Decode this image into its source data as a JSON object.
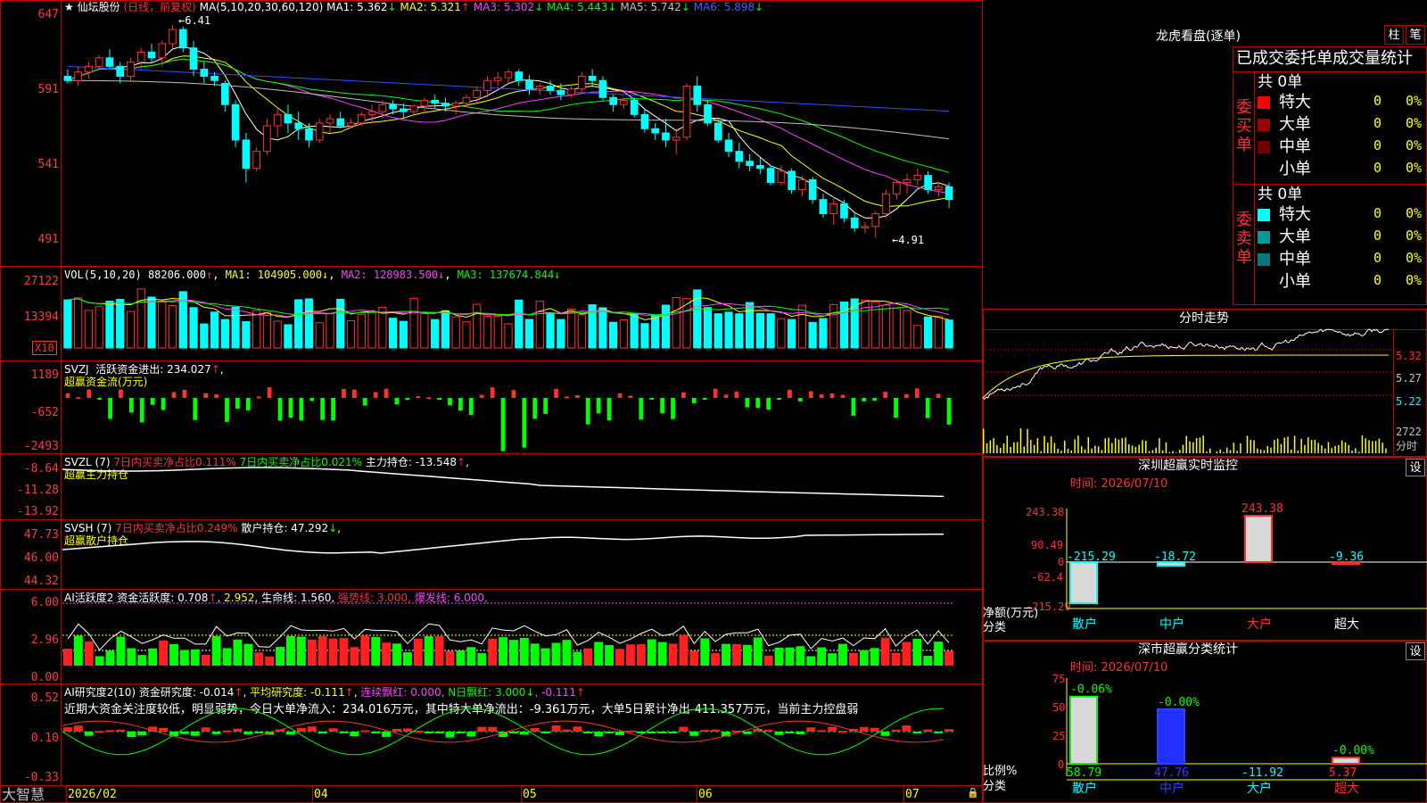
{
  "header": {
    "stock": "仙坛股份",
    "period": "(日线，前复权)",
    "ma_label": "MA(5,10,20,30,60,120)",
    "ma": [
      {
        "label": "MA1:",
        "value": "5.362",
        "arrow": "↓",
        "color": "#ffffff"
      },
      {
        "label": "MA2:",
        "value": "5.321",
        "arrow": "↑",
        "color": "#ffff00"
      },
      {
        "label": "MA3:",
        "value": "5.302",
        "arrow": "↓",
        "color": "#ff40ff"
      },
      {
        "label": "MA4:",
        "value": "5.443",
        "arrow": "↓",
        "color": "#00ff00"
      },
      {
        "label": "MA5:",
        "value": "5.742",
        "arrow": "↓",
        "color": "#c0c0c0"
      },
      {
        "label": "MA6:",
        "value": "5.898",
        "arrow": "↓",
        "color": "#3050ff"
      }
    ],
    "high_label": "6.41",
    "low_label": "4.91"
  },
  "axes": {
    "price": [
      "647",
      "591",
      "541",
      "491"
    ],
    "vol": [
      "27122",
      "13394"
    ],
    "vol_unit": "X10",
    "svzj": [
      "1189",
      "-652",
      "-2493"
    ],
    "svzl": [
      "-8.64",
      "-11.28",
      "-13.92"
    ],
    "svsh": [
      "47.73",
      "46.00",
      "44.32"
    ],
    "ai1": [
      "6.00",
      "2.96",
      "0.00"
    ],
    "ai2": [
      "0.52",
      "0.10",
      "-0.33"
    ]
  },
  "panels": {
    "vol": {
      "label": "VOL(5,10,20)",
      "value": "88206.000",
      "v_arrow": "↑",
      "ma1": "MA1: 104905.000↓",
      "ma2": "MA2: 128983.500↓",
      "ma3": "MA3: 137674.844↓"
    },
    "svzj": {
      "label": "SVZJ",
      "text": "活跃资金进出: 234.027",
      "arrow": "↑",
      "comma": ",",
      "sub": "超赢资金流(万元)"
    },
    "svzl": {
      "label": "SVZL (7)",
      "t1": "7日内买卖净占比0.111%",
      "t2": "7日内买卖净占比0.021%",
      "t3": "主力持仓: -13.548",
      "arrow": "↑",
      "comma": ",",
      "sub": "超赢主力持仓"
    },
    "svsh": {
      "label": "SVSH (7)",
      "t1": "7日内买卖净占比0.249%",
      "t2": "散户持仓: 47.292",
      "arrow": "↓",
      "comma": ",",
      "sub": "超赢散户持仓"
    },
    "ai1": {
      "label": "AI活跃度2",
      "t1": "资金活跃度: 0.708",
      "a1": "↑",
      "t2": ", 2.952,",
      "t3": "生命线: 1.560,",
      "t4": "强势线: 3.000,",
      "t5": "爆发线: 6.000,"
    },
    "ai2": {
      "label": "AI研究度2(10)",
      "t1": "资金研究度: -0.014",
      "a1": "↑",
      "t2": "平均研究度: -0.111",
      "a2": "↑",
      "t3": "连续飘红: 0.000,",
      "t4": "N日飘红: 3.000",
      "a4": "↓",
      "t5": ", -0.111",
      "a5": "↑",
      "desc": "近期大资金关注度较低，明显弱势，今日大单净流入：234.016万元，其中特大单净流出：-9.361万元，大单5日累计净出-411.357万元，当前主力控盘弱"
    }
  },
  "footer": {
    "brand": "大智慧",
    "dates": [
      "2026/02",
      "04",
      "05",
      "06",
      "07"
    ]
  },
  "right": {
    "title": "龙虎看盘(逐单)",
    "tabs": [
      "柱",
      "笔"
    ],
    "subtitle": "已成交委托单成交量统计",
    "buy_group": "委买单",
    "sell_group": "委卖单",
    "buy_total": "共 0单",
    "sell_total": "共 0单",
    "buy_rows": [
      {
        "name": "特大",
        "vol": "0",
        "pct": "0%",
        "color": "#ff0000"
      },
      {
        "name": "大单",
        "vol": "0",
        "pct": "0%",
        "color": "#9a0000"
      },
      {
        "name": "中单",
        "vol": "0",
        "pct": "0%",
        "color": "#700000"
      },
      {
        "name": "小单",
        "vol": "0",
        "pct": "0%",
        "color": ""
      }
    ],
    "sell_rows": [
      {
        "name": "特大",
        "vol": "0",
        "pct": "0%",
        "color": "#00ffff"
      },
      {
        "name": "大单",
        "vol": "0",
        "pct": "0%",
        "color": "#009a9a"
      },
      {
        "name": "中单",
        "vol": "0",
        "pct": "0%",
        "color": "#007a7a"
      },
      {
        "name": "小单",
        "vol": "0",
        "pct": "0%",
        "color": ""
      }
    ],
    "intraday": {
      "title": "分时走势",
      "prices": [
        "5.32",
        "5.27",
        "5.22"
      ],
      "vol": "2722",
      "vol_unit": "分时"
    },
    "monitor": {
      "title": "深圳超赢实时监控",
      "set": "设",
      "time": "时间: 2026/07/10",
      "y": [
        "243.38",
        "90.49",
        "0",
        "-62.4",
        "-215.29"
      ],
      "ylabel": "净额(万元)",
      "xlabel": "分类",
      "cats": [
        "散户",
        "中户",
        "大户",
        "超大"
      ],
      "values": [
        -215.29,
        -18.72,
        243.38,
        -9.36
      ],
      "value_labels": [
        "-215.29",
        "-18.72",
        "243.38",
        "-9.36"
      ]
    },
    "stats": {
      "title": "深市超赢分类统计",
      "set": "设",
      "time": "时间: 2026/07/10",
      "y": [
        "75",
        "50",
        "25",
        "0"
      ],
      "ylabel": "比例%",
      "xlabel": "分类",
      "cats": [
        "散户",
        "中户",
        "大户",
        "超大"
      ],
      "values": [
        58.79,
        47.76,
        -11.92,
        5.37
      ],
      "top_labels": [
        "-0.06%",
        "-0.00%",
        "",
        "-0.00%"
      ],
      "bottom_labels": [
        "58.79",
        "47.76",
        "-11.92",
        "5.37"
      ]
    }
  },
  "chart_data": {
    "type": "candlestick",
    "title": "仙坛股份 (日线，前复权)",
    "xlabel": "",
    "ylabel": "",
    "x_ticks": [
      "2026/02",
      "04",
      "05",
      "06",
      "07"
    ],
    "ylim": [
      4.8,
      6.5
    ],
    "annotations": [
      {
        "text": "6.41",
        "kind": "high"
      },
      {
        "text": "4.91",
        "kind": "low"
      }
    ],
    "candles": [
      [
        6.05,
        6.1,
        6.0,
        6.02
      ],
      [
        6.02,
        6.12,
        5.98,
        6.08
      ],
      [
        6.08,
        6.15,
        6.03,
        6.12
      ],
      [
        6.12,
        6.2,
        6.1,
        6.18
      ],
      [
        6.18,
        6.24,
        6.1,
        6.12
      ],
      [
        6.12,
        6.15,
        6.0,
        6.05
      ],
      [
        6.05,
        6.18,
        6.02,
        6.15
      ],
      [
        6.15,
        6.25,
        6.1,
        6.22
      ],
      [
        6.22,
        6.28,
        6.15,
        6.18
      ],
      [
        6.18,
        6.3,
        6.12,
        6.28
      ],
      [
        6.28,
        6.41,
        6.25,
        6.38
      ],
      [
        6.38,
        6.4,
        6.22,
        6.25
      ],
      [
        6.25,
        6.3,
        6.05,
        6.1
      ],
      [
        6.1,
        6.15,
        6.0,
        6.05
      ],
      [
        6.05,
        6.08,
        5.98,
        6.02
      ],
      [
        6.0,
        6.02,
        5.8,
        5.85
      ],
      [
        5.85,
        5.88,
        5.55,
        5.6
      ],
      [
        5.6,
        5.65,
        5.3,
        5.4
      ],
      [
        5.4,
        5.55,
        5.38,
        5.52
      ],
      [
        5.52,
        5.75,
        5.5,
        5.7
      ],
      [
        5.7,
        5.82,
        5.62,
        5.78
      ],
      [
        5.78,
        5.85,
        5.65,
        5.72
      ],
      [
        5.72,
        5.8,
        5.6,
        5.68
      ],
      [
        5.68,
        5.72,
        5.55,
        5.6
      ],
      [
        5.6,
        5.75,
        5.58,
        5.72
      ],
      [
        5.72,
        5.78,
        5.65,
        5.75
      ],
      [
        5.75,
        5.8,
        5.68,
        5.7
      ],
      [
        5.7,
        5.75,
        5.68,
        5.72
      ],
      [
        5.72,
        5.8,
        5.7,
        5.78
      ],
      [
        5.78,
        5.85,
        5.72,
        5.8
      ],
      [
        5.8,
        5.88,
        5.75,
        5.85
      ],
      [
        5.85,
        5.88,
        5.78,
        5.82
      ],
      [
        5.82,
        5.86,
        5.75,
        5.8
      ],
      [
        5.8,
        5.85,
        5.78,
        5.84
      ],
      [
        5.84,
        5.9,
        5.8,
        5.88
      ],
      [
        5.88,
        5.92,
        5.82,
        5.86
      ],
      [
        5.86,
        5.9,
        5.8,
        5.84
      ],
      [
        5.84,
        5.88,
        5.78,
        5.86
      ],
      [
        5.86,
        5.92,
        5.84,
        5.9
      ],
      [
        5.9,
        5.98,
        5.86,
        5.95
      ],
      [
        5.95,
        6.05,
        5.9,
        6.02
      ],
      [
        6.02,
        6.08,
        5.98,
        6.04
      ],
      [
        6.04,
        6.1,
        6.0,
        6.08
      ],
      [
        6.08,
        6.1,
        5.98,
        6.02
      ],
      [
        6.02,
        6.06,
        5.92,
        5.96
      ],
      [
        5.96,
        6.0,
        5.92,
        5.98
      ],
      [
        5.98,
        6.02,
        5.92,
        5.95
      ],
      [
        5.95,
        6.0,
        5.88,
        5.92
      ],
      [
        5.92,
        5.98,
        5.9,
        5.96
      ],
      [
        5.96,
        6.08,
        5.94,
        6.05
      ],
      [
        6.05,
        6.1,
        5.98,
        6.02
      ],
      [
        6.02,
        6.05,
        5.88,
        5.9
      ],
      [
        5.9,
        5.92,
        5.8,
        5.85
      ],
      [
        5.85,
        5.9,
        5.82,
        5.88
      ],
      [
        5.88,
        5.9,
        5.76,
        5.78
      ],
      [
        5.78,
        5.82,
        5.65,
        5.68
      ],
      [
        5.68,
        5.72,
        5.6,
        5.65
      ],
      [
        5.65,
        5.75,
        5.55,
        5.6
      ],
      [
        5.6,
        5.68,
        5.5,
        5.62
      ],
      [
        5.62,
        6.0,
        5.6,
        5.98
      ],
      [
        5.98,
        6.05,
        5.8,
        5.85
      ],
      [
        5.85,
        5.88,
        5.7,
        5.72
      ],
      [
        5.72,
        5.75,
        5.58,
        5.6
      ],
      [
        5.6,
        5.65,
        5.48,
        5.52
      ],
      [
        5.52,
        5.58,
        5.4,
        5.45
      ],
      [
        5.45,
        5.5,
        5.38,
        5.42
      ],
      [
        5.42,
        5.48,
        5.36,
        5.4
      ],
      [
        5.4,
        5.42,
        5.28,
        5.3
      ],
      [
        5.3,
        5.42,
        5.28,
        5.38
      ],
      [
        5.38,
        5.4,
        5.22,
        5.25
      ],
      [
        5.25,
        5.35,
        5.2,
        5.32
      ],
      [
        5.32,
        5.34,
        5.15,
        5.18
      ],
      [
        5.18,
        5.22,
        5.05,
        5.08
      ],
      [
        5.08,
        5.2,
        5.0,
        5.15
      ],
      [
        5.15,
        5.18,
        5.02,
        5.05
      ],
      [
        5.05,
        5.08,
        4.95,
        4.98
      ],
      [
        4.98,
        5.02,
        4.94,
        4.99
      ],
      [
        4.99,
        5.1,
        4.91,
        5.08
      ],
      [
        5.08,
        5.25,
        5.05,
        5.22
      ],
      [
        5.22,
        5.32,
        5.18,
        5.3
      ],
      [
        5.3,
        5.36,
        5.22,
        5.32
      ],
      [
        5.32,
        5.4,
        5.28,
        5.35
      ],
      [
        5.35,
        5.38,
        5.22,
        5.25
      ],
      [
        5.25,
        5.3,
        5.2,
        5.27
      ],
      [
        5.27,
        5.3,
        5.12,
        5.18
      ]
    ]
  }
}
